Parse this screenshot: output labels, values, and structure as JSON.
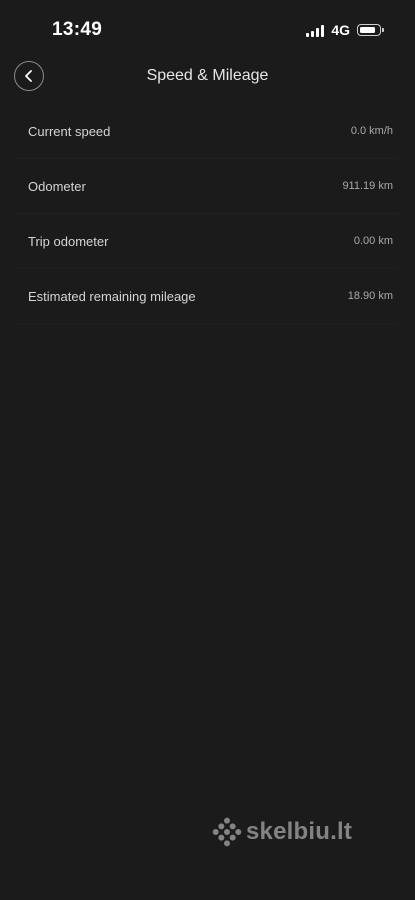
{
  "status_bar": {
    "time": "13:49",
    "network": "4G",
    "battery_level": 0.85,
    "icons": [
      "signal-bars-icon",
      "battery-icon"
    ]
  },
  "header": {
    "title": "Speed & Mileage",
    "back_icon": "chevron-left-icon"
  },
  "rows": [
    {
      "label": "Current speed",
      "value": "0.0 km/h"
    },
    {
      "label": "Odometer",
      "value": "911.19 km"
    },
    {
      "label": "Trip odometer",
      "value": "0.00 km"
    },
    {
      "label": "Estimated remaining mileage",
      "value": "18.90 km"
    }
  ],
  "watermark": {
    "text": "skelbiu.lt"
  },
  "colors": {
    "background": "#1b1b1b",
    "text_primary": "#e6e6e6",
    "text_secondary": "#a9a9a9"
  }
}
